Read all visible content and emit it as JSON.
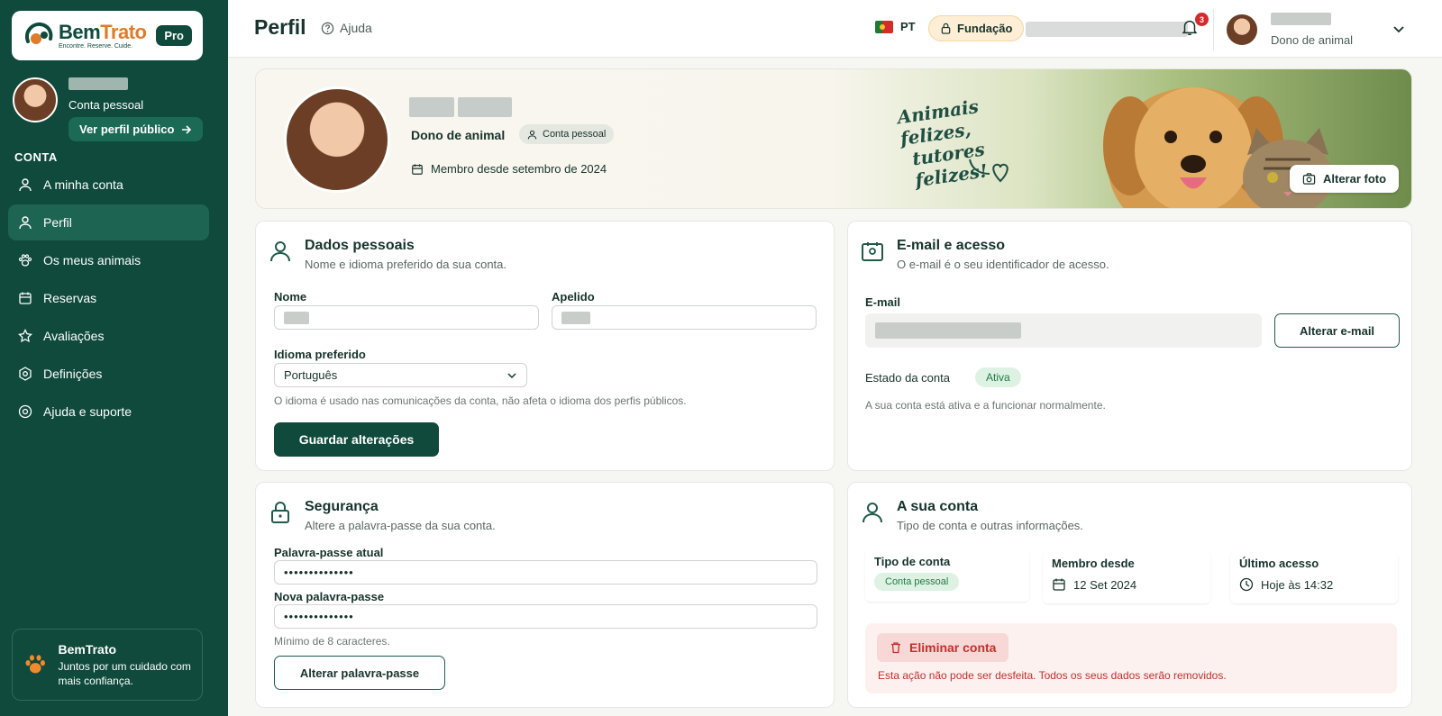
{
  "brand": {
    "name_part1": "Bem",
    "name_part2": "Trato",
    "tagline": "Encontre. Reserve. Cuide.",
    "badge": "Pro"
  },
  "sidebar": {
    "account_type": "Conta pessoal",
    "public_profile_button": "Ver perfil público",
    "section_label": "CONTA",
    "items": [
      {
        "label": "A minha conta",
        "icon": "user-icon",
        "active": false
      },
      {
        "label": "Perfil",
        "icon": "user-icon",
        "active": true
      },
      {
        "label": "Os meus animais",
        "icon": "paw-icon",
        "active": false
      },
      {
        "label": "Reservas",
        "icon": "calendar-icon",
        "active": false
      },
      {
        "label": "Avaliações",
        "icon": "star-icon",
        "active": false
      },
      {
        "label": "Definições",
        "icon": "gear-icon",
        "active": false
      },
      {
        "label": "Ajuda e suporte",
        "icon": "help-icon",
        "active": false
      }
    ],
    "footer": {
      "title": "BemTrato",
      "text": "Juntos por um cuidado com mais confiança."
    }
  },
  "topbar": {
    "title": "Perfil",
    "help": "Ajuda",
    "language": "PT",
    "foundation_badge": "Fundação",
    "notifications_count": "3",
    "user_role": "Dono de animal"
  },
  "hero": {
    "role": "Dono de animal",
    "chip": "Conta pessoal",
    "member_since": "Membro desde setembro de 2024",
    "slogan_line1": "Animais felizes,",
    "slogan_line2": "tutores felizes!",
    "change_photo_button": "Alterar foto"
  },
  "personal": {
    "title": "Dados pessoais",
    "subtitle": "Nome e idioma preferido da sua conta.",
    "first_name_label": "Nome",
    "last_name_label": "Apelido",
    "language_label": "Idioma preferido",
    "language_value": "Português",
    "language_hint": "O idioma é usado nas comunicações da conta, não afeta o idioma dos perfis públicos.",
    "save_button": "Guardar alterações"
  },
  "email": {
    "title": "E-mail e acesso",
    "subtitle": "O e-mail é o seu identificador de acesso.",
    "email_label": "E-mail",
    "change_button": "Alterar e-mail",
    "status_label": "Estado da conta",
    "status_value": "Ativa",
    "status_text": "A sua conta está ativa e a funcionar normalmente."
  },
  "security": {
    "title": "Segurança",
    "subtitle": "Altere a palavra-passe da sua conta.",
    "current_label": "Palavra-passe atual",
    "current_value": "••••••••••••••",
    "new_label": "Nova palavra-passe",
    "new_value": "••••••••••••••",
    "hint": "Mínimo de 8 caracteres.",
    "change_button": "Alterar palavra-passe"
  },
  "account": {
    "title": "A sua conta",
    "subtitle": "Tipo de conta e outras informações.",
    "type_label": "Tipo de conta",
    "type_value": "Conta pessoal",
    "member_label": "Membro desde",
    "member_value": "12 Set 2024",
    "last_label": "Último acesso",
    "last_value": "Hoje às 14:32",
    "delete_button": "Eliminar conta",
    "delete_warning": "Esta ação não pode ser desfeita. Todos os seus dados serão removidos."
  },
  "colors": {
    "primary": "#0f4a3c",
    "accent_orange": "#e07b2a",
    "danger": "#c4302b",
    "success": "#1f7a45"
  }
}
